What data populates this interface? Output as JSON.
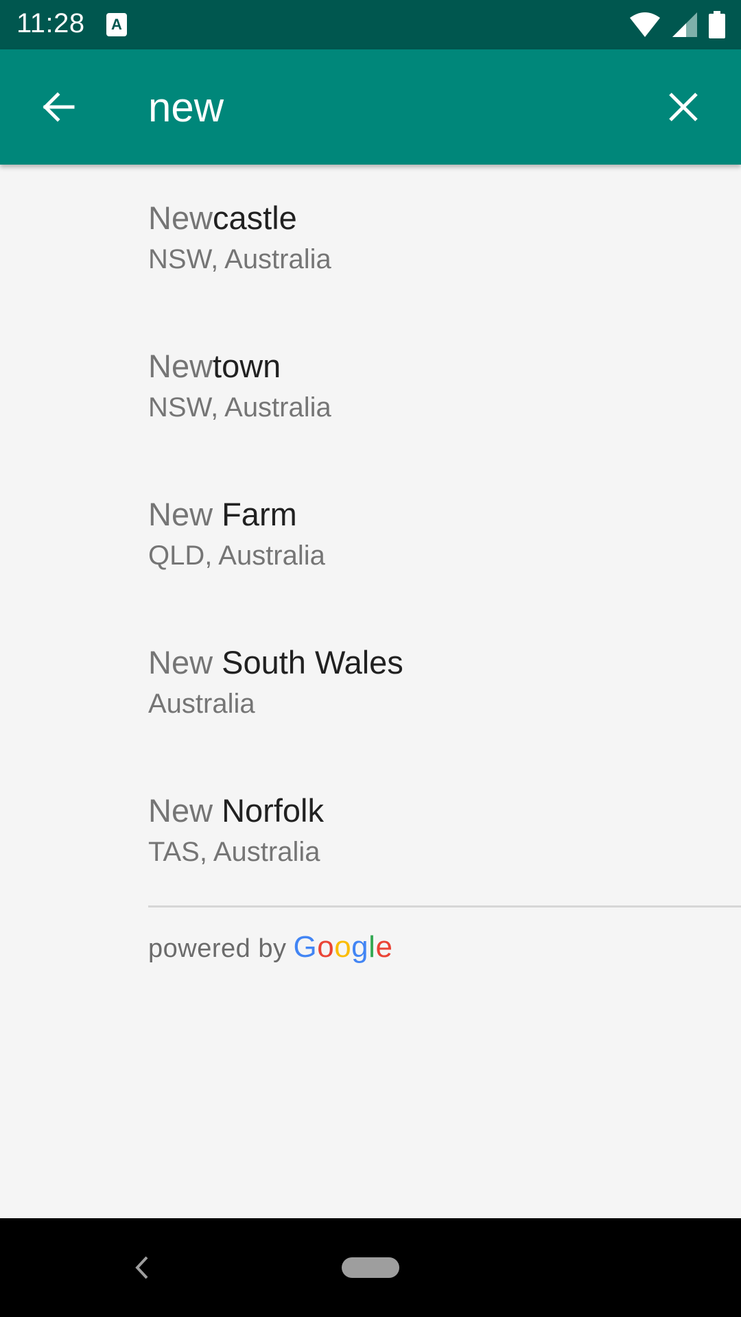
{
  "status_bar": {
    "time": "11:28",
    "notification_icon": "a-text-notification-icon",
    "icons": [
      "wifi-icon",
      "cell-signal-icon",
      "battery-icon"
    ]
  },
  "app_bar": {
    "back_icon": "arrow-back-icon",
    "search_value": "new",
    "clear_icon": "close-icon",
    "background_color": "#00877a"
  },
  "results": [
    {
      "match": "New",
      "rest": "castle",
      "subtitle": "NSW, Australia"
    },
    {
      "match": "New",
      "rest": "town",
      "subtitle": "NSW, Australia"
    },
    {
      "match": "New",
      "rest": " Farm",
      "subtitle": "QLD, Australia"
    },
    {
      "match": "New",
      "rest": " South Wales",
      "subtitle": "Australia"
    },
    {
      "match": "New",
      "rest": " Norfolk",
      "subtitle": "TAS, Australia"
    }
  ],
  "attribution": {
    "prefix": "powered by",
    "brand_letters": [
      "G",
      "o",
      "o",
      "g",
      "l",
      "e"
    ],
    "brand_colors": [
      "#4285F4",
      "#EA4335",
      "#FBBC05",
      "#4285F4",
      "#34A853",
      "#EA4335"
    ]
  },
  "nav_bar": {
    "back_icon": "nav-back-icon",
    "home_icon": "home-pill-icon"
  }
}
